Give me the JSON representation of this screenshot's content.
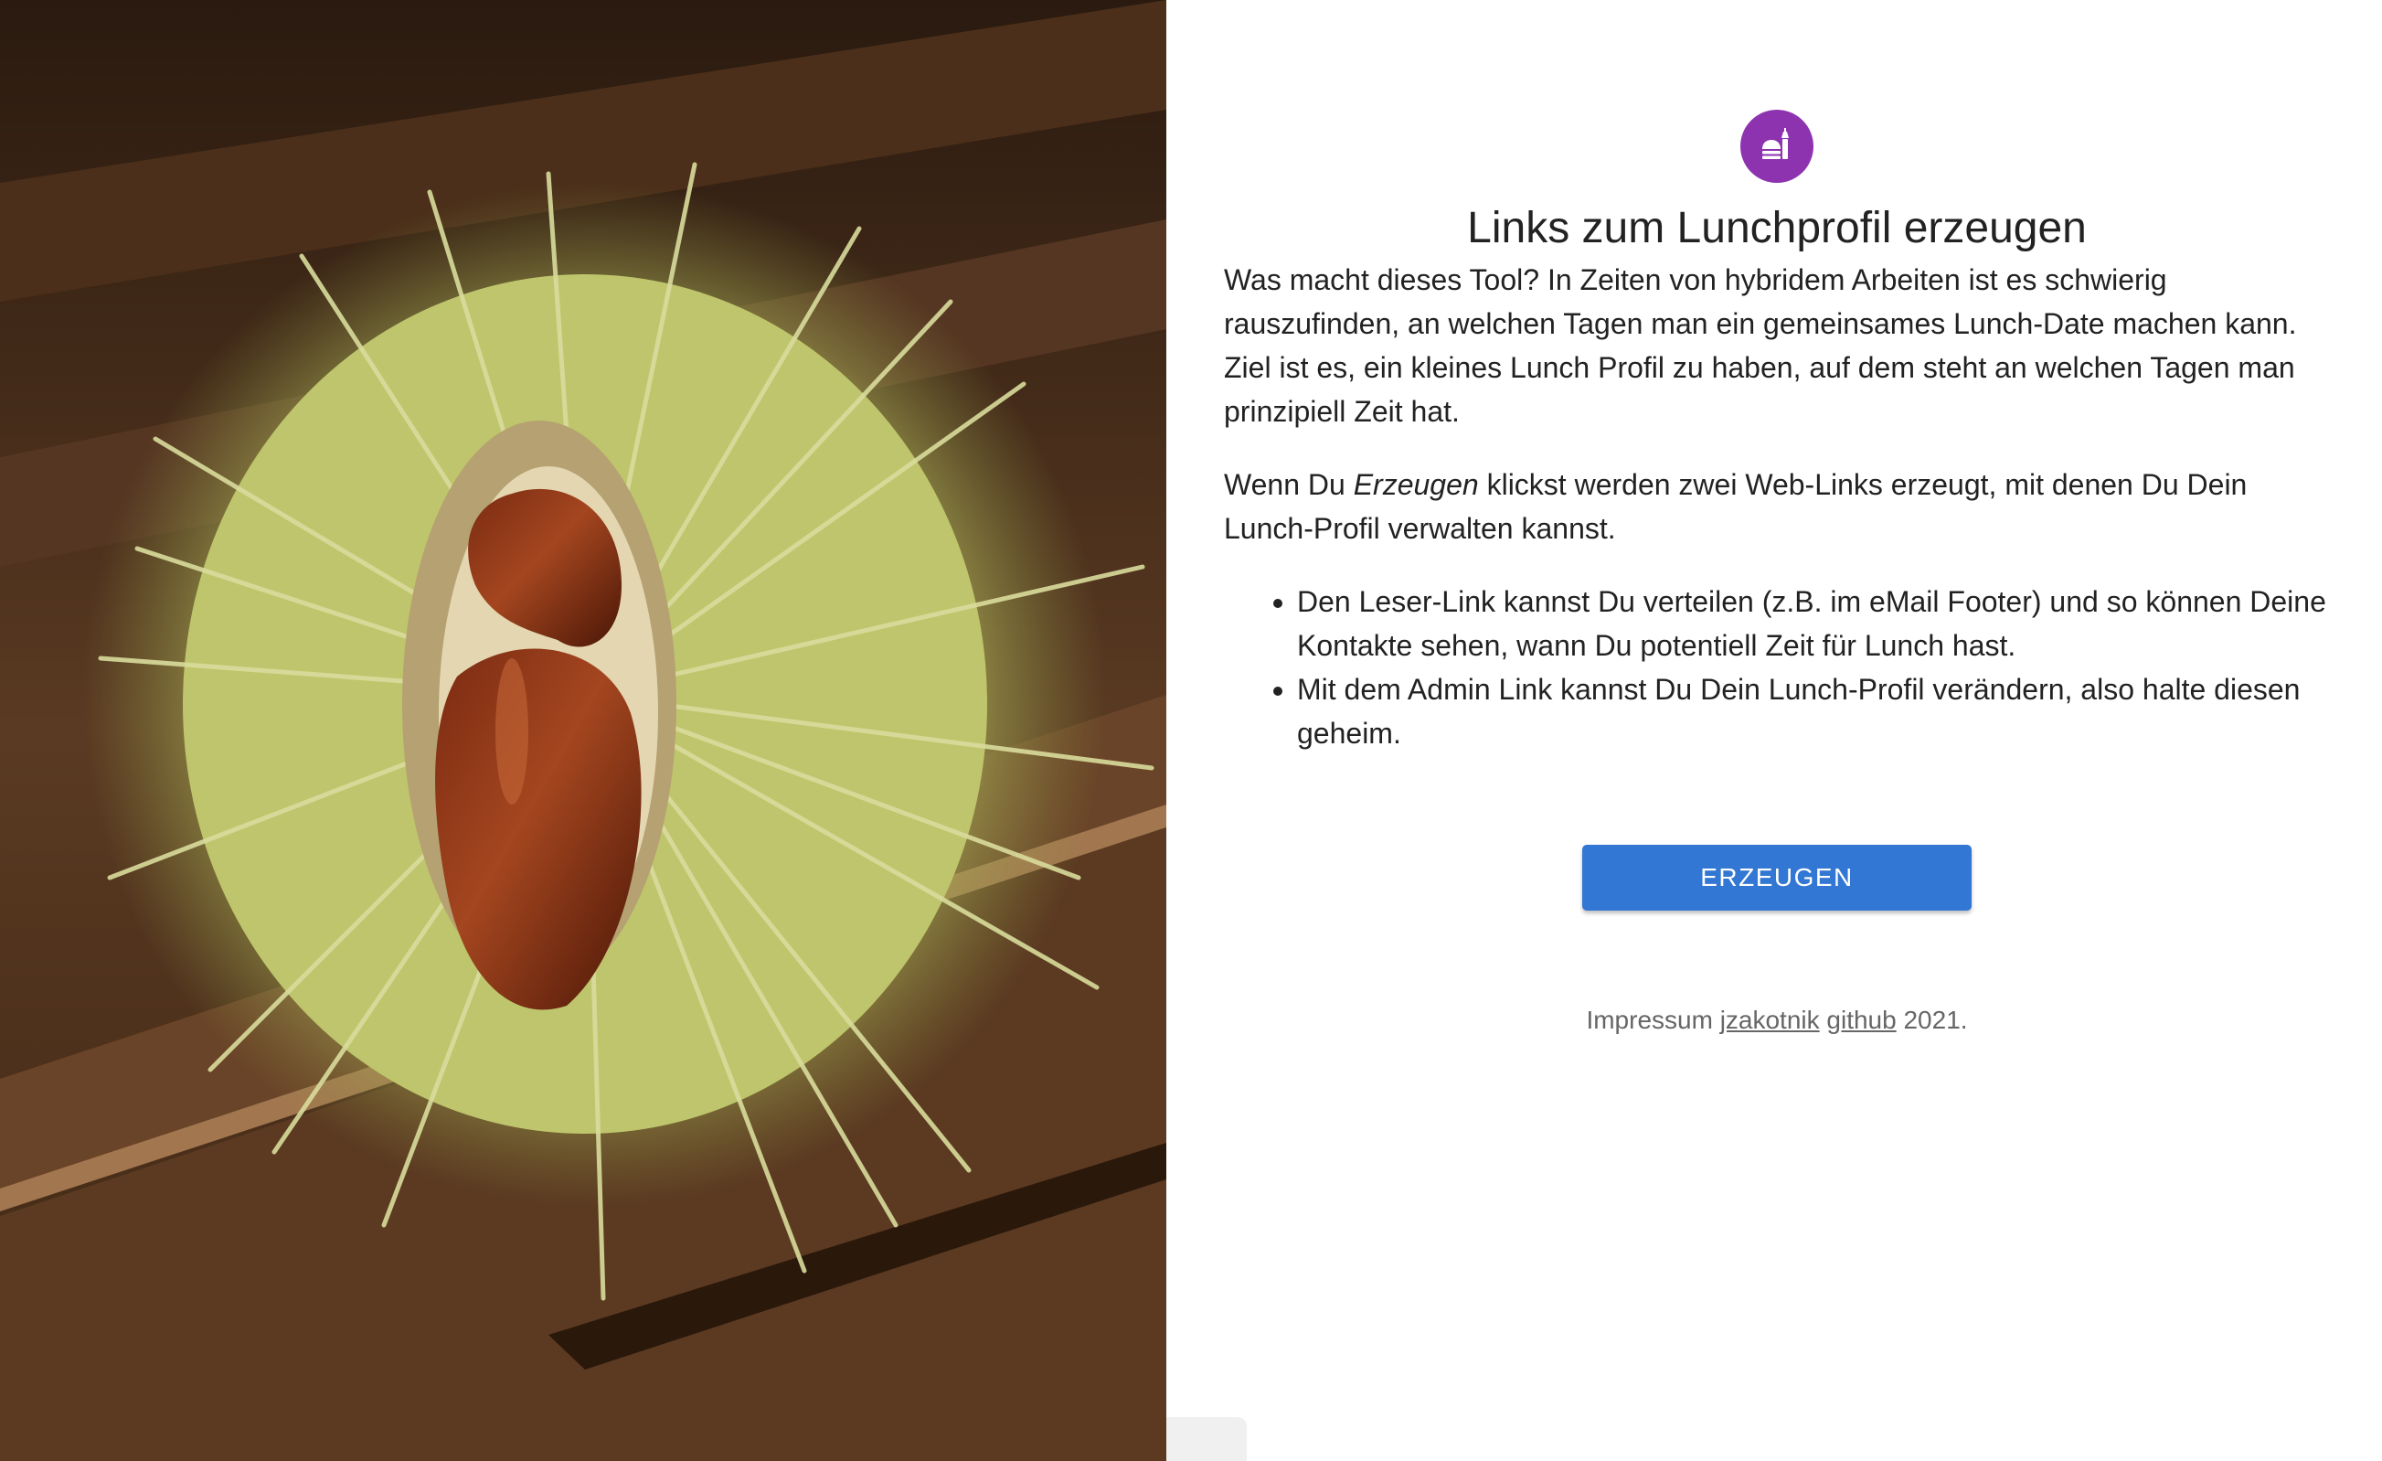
{
  "photo": {
    "alt": "chestnut"
  },
  "header": {
    "icon": "lunch-dining-icon",
    "title": "Links zum Lunchprofil erzeugen"
  },
  "intro": {
    "text": "Was macht dieses Tool? In Zeiten von hybridem Arbeiten ist es schwierig rauszufinden, an welchen Tagen man ein gemeinsames Lunch-Date machen kann. Ziel ist es, ein kleines Lunch Profil zu haben, auf dem steht an welchen Tagen man prinzipiell Zeit hat."
  },
  "howto": {
    "prefix": "Wenn Du ",
    "emphasis": "Erzeugen",
    "suffix": " klickst werden zwei Web-Links erzeugt, mit denen Du Dein Lunch-Profil verwalten kannst."
  },
  "bullets": [
    "Den Leser-Link kannst Du verteilen (z.B. im eMail Footer) und so können Deine Kontakte sehen, wann Du potentiell Zeit für Lunch hast.",
    "Mit dem Admin Link kannst Du Dein Lunch-Profil verändern, also halte diesen geheim."
  ],
  "actions": {
    "create_label": "ERZEUGEN"
  },
  "footer": {
    "prefix": "Impressum ",
    "link1": "jzakotnik",
    "link2": "github",
    "suffix": " 2021."
  },
  "colors": {
    "accent_purple": "#8e33b0",
    "button_blue": "#3277d3"
  }
}
